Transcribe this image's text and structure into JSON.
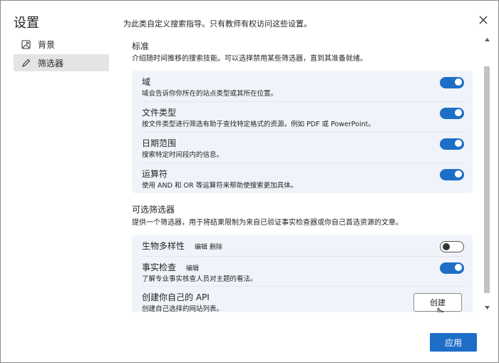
{
  "dialog": {
    "title": "设置",
    "intro": "为此类自定义搜索指导。只有教师有权访问这些设置。"
  },
  "nav": {
    "items": [
      {
        "label": "背景",
        "icon": "image-icon"
      },
      {
        "label": "筛选器",
        "icon": "pencil-icon",
        "selected": true
      }
    ]
  },
  "standard": {
    "title": "标准",
    "desc": "介绍随时间推移的搜索技能。可以选择禁用某些筛选器，直到其准备就绪。",
    "items": [
      {
        "title": "域",
        "desc": "域会告诉你你所在的站点类型或其所在位置。",
        "on": true
      },
      {
        "title": "文件类型",
        "desc": "按文件类型进行筛选有助于查找特定格式的资源。例如 PDF 或 PowerPoint。",
        "on": true
      },
      {
        "title": "日期范围",
        "desc": "搜索特定时间段内的信息。",
        "on": true
      },
      {
        "title": "运算符",
        "desc": "使用 AND 和 OR 等运算符来帮助使搜索更加具体。",
        "on": true
      }
    ]
  },
  "optional": {
    "title": "可选筛选器",
    "desc": "提供一个筛选器，用于将结果限制为来自已验证事实检查器或你自己首选资源的文章。",
    "items": [
      {
        "title": "生物多样性",
        "edit": "编辑",
        "delete": "删除",
        "on": false
      },
      {
        "title": "事实检查",
        "edit": "编辑",
        "desc": "了解专业事实核查人员对主题的看法。",
        "on": true
      },
      {
        "title": "创建你自己的 API",
        "desc": "创建自己选择的网站列表。",
        "button": "创建"
      }
    ]
  },
  "footer": {
    "apply": "应用"
  },
  "colors": {
    "accent": "#1e6ec8",
    "card": "#f0f4fa"
  }
}
